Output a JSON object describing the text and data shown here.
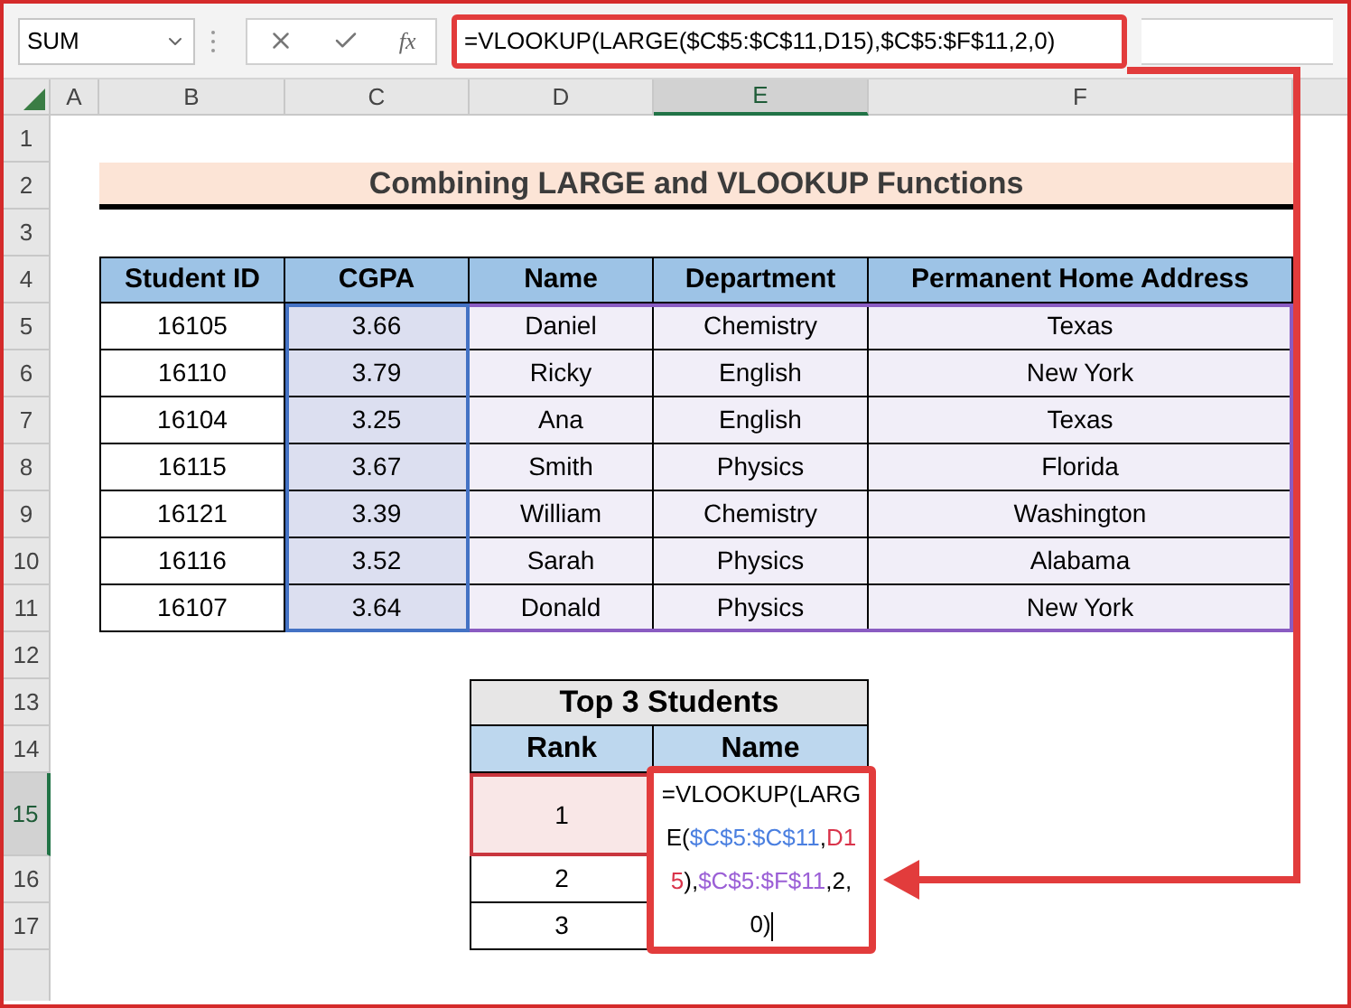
{
  "name_box": "SUM",
  "fx_label": "fx",
  "formula": "=VLOOKUP(LARGE($C$5:$C$11,D15),$C$5:$F$11,2,0)",
  "columns": [
    {
      "label": "A",
      "selected": false
    },
    {
      "label": "B",
      "selected": false
    },
    {
      "label": "C",
      "selected": false
    },
    {
      "label": "D",
      "selected": false
    },
    {
      "label": "E",
      "selected": true
    },
    {
      "label": "F",
      "selected": false
    }
  ],
  "rows": [
    {
      "label": "1",
      "selected": false
    },
    {
      "label": "2",
      "selected": false
    },
    {
      "label": "3",
      "selected": false
    },
    {
      "label": "4",
      "selected": false
    },
    {
      "label": "5",
      "selected": false
    },
    {
      "label": "6",
      "selected": false
    },
    {
      "label": "7",
      "selected": false
    },
    {
      "label": "8",
      "selected": false
    },
    {
      "label": "9",
      "selected": false
    },
    {
      "label": "10",
      "selected": false
    },
    {
      "label": "11",
      "selected": false
    },
    {
      "label": "12",
      "selected": false
    },
    {
      "label": "13",
      "selected": false
    },
    {
      "label": "14",
      "selected": false
    },
    {
      "label": "15",
      "selected": true
    },
    {
      "label": "16",
      "selected": false
    },
    {
      "label": "17",
      "selected": false
    }
  ],
  "title": "Combining LARGE and VLOOKUP Functions",
  "table": {
    "columns": [
      "Student ID",
      "CGPA",
      "Name",
      "Department",
      "Permanent Home Address"
    ],
    "rows": [
      [
        "16105",
        "3.66",
        "Daniel",
        "Chemistry",
        "Texas"
      ],
      [
        "16110",
        "3.79",
        "Ricky",
        "English",
        "New York"
      ],
      [
        "16104",
        "3.25",
        "Ana",
        "English",
        "Texas"
      ],
      [
        "16115",
        "3.67",
        "Smith",
        "Physics",
        "Florida"
      ],
      [
        "16121",
        "3.39",
        "William",
        "Chemistry",
        "Washington"
      ],
      [
        "16116",
        "3.52",
        "Sarah",
        "Physics",
        "Alabama"
      ],
      [
        "16107",
        "3.64",
        "Donald",
        "Physics",
        "New York"
      ]
    ]
  },
  "top_table": {
    "title": "Top 3 Students",
    "columns": [
      "Rank",
      "Name"
    ],
    "rows": [
      {
        "rank": "1",
        "referenced": true
      },
      {
        "rank": "2",
        "referenced": false
      },
      {
        "rank": "3",
        "referenced": false
      }
    ]
  },
  "editing_cell": {
    "segments": [
      {
        "text": "=VLOOKUP(",
        "color": "#000000"
      },
      {
        "text": "LARGE(",
        "color": "#000000"
      },
      {
        "text": "$C$5:$C$11",
        "color": "#4a7fe0"
      },
      {
        "text": ",",
        "color": "#000000"
      },
      {
        "text": "D15",
        "color": "#d9334a"
      },
      {
        "text": "),",
        "color": "#000000"
      },
      {
        "text": "$C$5:$F$11",
        "color": "#9b5fd6"
      },
      {
        "text": ",2,0)",
        "color": "#000000"
      }
    ]
  }
}
